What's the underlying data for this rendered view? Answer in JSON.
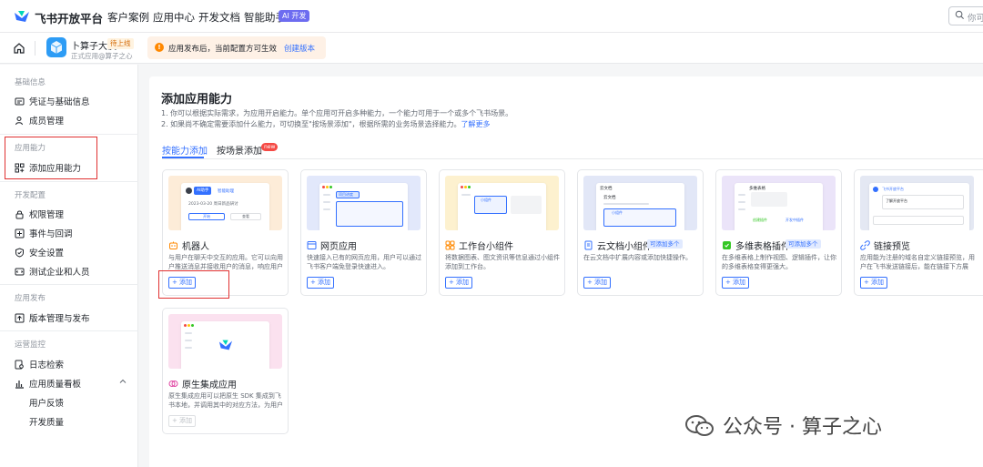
{
  "topnav": {
    "brand": "飞书开放平台",
    "items": [
      "客户案例",
      "应用中心",
      "开发文档",
      "智能助手"
    ],
    "ai_badge": "AI 开发",
    "search_placeholder": "你可"
  },
  "appbar": {
    "app_name": "卜算子大侠",
    "status_badge": "待上线",
    "app_sub": "正式应用@算子之心",
    "notice_text": "应用发布后，当前配置方可生效",
    "notice_link": "创建版本"
  },
  "sidebar": {
    "groups": [
      {
        "label": "基础信息",
        "items": [
          {
            "label": "凭证与基础信息"
          },
          {
            "label": "成员管理"
          }
        ]
      },
      {
        "label": "应用能力",
        "items": [
          {
            "label": "添加应用能力"
          }
        ]
      },
      {
        "label": "开发配置",
        "items": [
          {
            "label": "权限管理"
          },
          {
            "label": "事件与回调"
          },
          {
            "label": "安全设置"
          },
          {
            "label": "测试企业和人员"
          }
        ]
      },
      {
        "label": "应用发布",
        "items": [
          {
            "label": "版本管理与发布"
          }
        ]
      },
      {
        "label": "运营监控",
        "items": [
          {
            "label": "日志检索"
          },
          {
            "label": "应用质量看板"
          },
          {
            "label": "用户反馈"
          },
          {
            "label": "开发质量"
          }
        ]
      }
    ]
  },
  "main": {
    "title": "添加应用能力",
    "desc1": "1. 你可以根据实际需求，为应用开启能力。单个应用可开启多种能力，一个能力可用于一个或多个飞书场景。",
    "desc2": "2. 如果尚不确定需要添加什么能力，可切换至\"按场景添加\"，根据所需的业务场景选择能力。",
    "desc2_link": "了解更多",
    "tabs": [
      {
        "label": "按能力添加"
      },
      {
        "label": "按场景添加"
      }
    ],
    "new_badge": "new",
    "cards": [
      {
        "title": "机器人",
        "desc": "与用户在聊天中交互的应用。它可以向用户推送消息并接收用户的消息，响应用户的指令…",
        "add": "+ 添加",
        "preview": {
          "tag": "AI助手",
          "sub": "智能助理",
          "date": "2023-03-20 周日新品研讨",
          "btn1": "开始",
          "btn2": "查看"
        }
      },
      {
        "title": "网页应用",
        "desc": "快速接入已有的网页应用，用户可以通过飞书客户端免登录快速进入。",
        "add": "+ 添加",
        "preview": {
          "sel": "项目进度"
        }
      },
      {
        "title": "工作台小组件",
        "desc": "将数据图表、图文资讯等信息通过小组件添加到工作台。",
        "add": "+ 添加",
        "preview": {
          "sel": "小组件"
        }
      },
      {
        "title": "云文档小组件",
        "badge": "可添加多个",
        "desc": "在云文档中扩展内容或添加快捷操作。",
        "add": "+ 添加",
        "preview": {
          "h": "云文档",
          "sub": "云文档",
          "sel": "小组件"
        }
      },
      {
        "title": "多维表格插件",
        "badge": "可添加多个",
        "desc": "在多维表格上制作视图、逻辑插件，让你的多维表格变得更强大。",
        "add": "+ 添加",
        "preview": {
          "h": "多维表格",
          "b1": "创建插件",
          "b2": "开发中插件"
        }
      },
      {
        "title": "链接预览",
        "desc": "应用能为注册的域名自定义链接预览，用户在飞书发送链接后，能在链接下方展示…",
        "add": "+ 添加",
        "preview": {
          "t1": "飞书开放平台",
          "t2": "了解开放平台"
        }
      },
      {
        "title": "原生集成应用",
        "desc": "原生集成应用可以把原生 SDK 集成到飞书本地，并调用其中的对应方法，为用户提…",
        "add": "+ 添加"
      }
    ]
  },
  "watermark": "公众号 · 算子之心",
  "colors": {
    "accent": "#3370ff",
    "highlight": "#e03131",
    "ai_badge": "#6d6cf0",
    "notice_bg": "#fef1e6"
  },
  "icons": [
    "home-icon",
    "robot-icon",
    "web-app-icon",
    "widget-icon",
    "doc-widget-icon",
    "bitable-plugin-icon",
    "link-preview-icon",
    "native-app-icon",
    "search-icon",
    "wechat-icon"
  ]
}
